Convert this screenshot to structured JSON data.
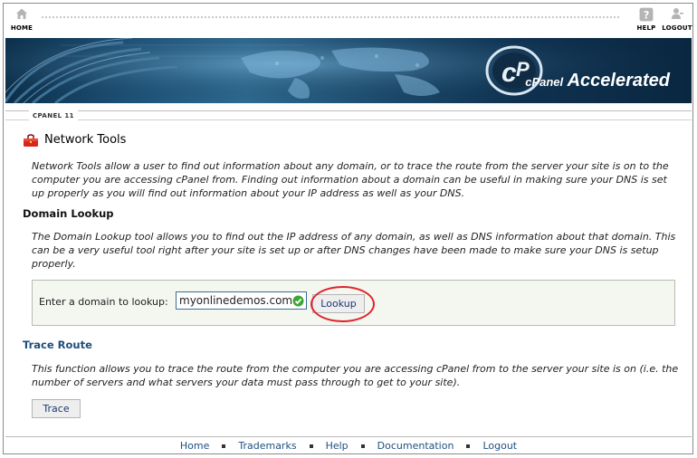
{
  "topnav": {
    "home_label": "HOME",
    "help_label": "HELP",
    "logout_label": "LOGOUT"
  },
  "banner": {
    "brand_c1": "cPanel",
    "brand_c2": "Accelerated",
    "brand_color": "#ffffff"
  },
  "version_label": "CPANEL 11",
  "page": {
    "title": "Network Tools",
    "intro": "Network Tools allow a user to find out information about any domain, or to trace the route from the server your site is on to the computer you are accessing cPanel from. Finding out information about a domain can be useful in making sure your DNS is set up properly as you will find out information about your IP address as well as your DNS."
  },
  "domain_lookup": {
    "heading": "Domain Lookup",
    "description": "The Domain Lookup tool allows you to find out the IP address of any domain, as well as DNS information about that domain. This can be a very useful tool right after your site is set up or after DNS changes have been made to make sure your DNS is setup properly.",
    "input_label": "Enter a domain to lookup:",
    "input_value": "myonlinedemos.com",
    "button_label": "Lookup"
  },
  "trace_route": {
    "heading": "Trace Route",
    "description": "This function allows you to trace the route from the computer you are accessing cPanel from to the server your site is on (i.e. the number of servers and what servers your data must pass through to get to your site).",
    "button_label": "Trace"
  },
  "footer": {
    "links": [
      "Home",
      "Trademarks",
      "Help",
      "Documentation",
      "Logout"
    ]
  },
  "colors": {
    "accent_heading": "#1f4f7c",
    "link": "#1c5082",
    "highlight_circle": "#e0232a"
  }
}
